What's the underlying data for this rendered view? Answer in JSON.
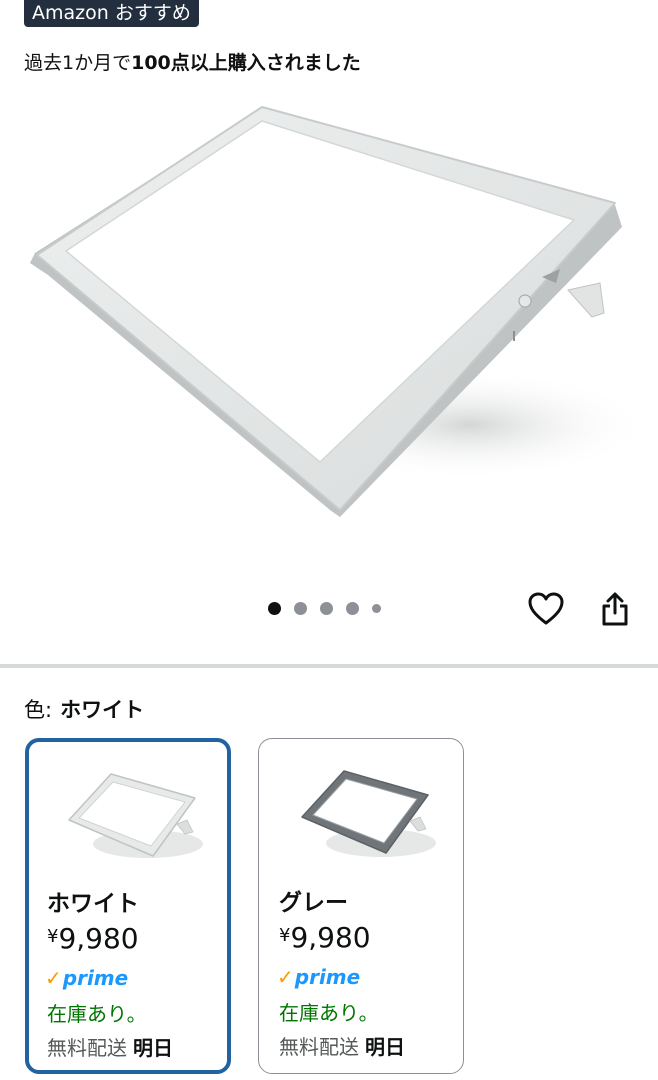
{
  "badge": {
    "label": "Amazon おすすめ"
  },
  "purchase_info": {
    "prefix": "過去1か月で",
    "highlight": "100点以上購入されました"
  },
  "gallery": {
    "image_count": 5,
    "active_index": 0,
    "icons": [
      "heart-icon",
      "share-icon"
    ]
  },
  "color_selector": {
    "label": "色:",
    "selected_value": "ホワイト",
    "options": [
      {
        "name": "ホワイト",
        "currency": "¥",
        "price": "9,980",
        "prime_check": "✓",
        "prime": "prime",
        "stock": "在庫あり。",
        "shipping": "無料配送",
        "delivery": "明日",
        "selected": true
      },
      {
        "name": "グレー",
        "currency": "¥",
        "price": "9,980",
        "prime_check": "✓",
        "prime": "prime",
        "stock": "在庫あり。",
        "shipping": "無料配送",
        "delivery": "明日",
        "selected": false
      }
    ]
  },
  "colors": {
    "badge_bg": "#232f3e",
    "selected_border": "#2162a1",
    "in_stock": "#007600",
    "prime_blue": "#1a98ff",
    "prime_check": "#ff9900"
  }
}
